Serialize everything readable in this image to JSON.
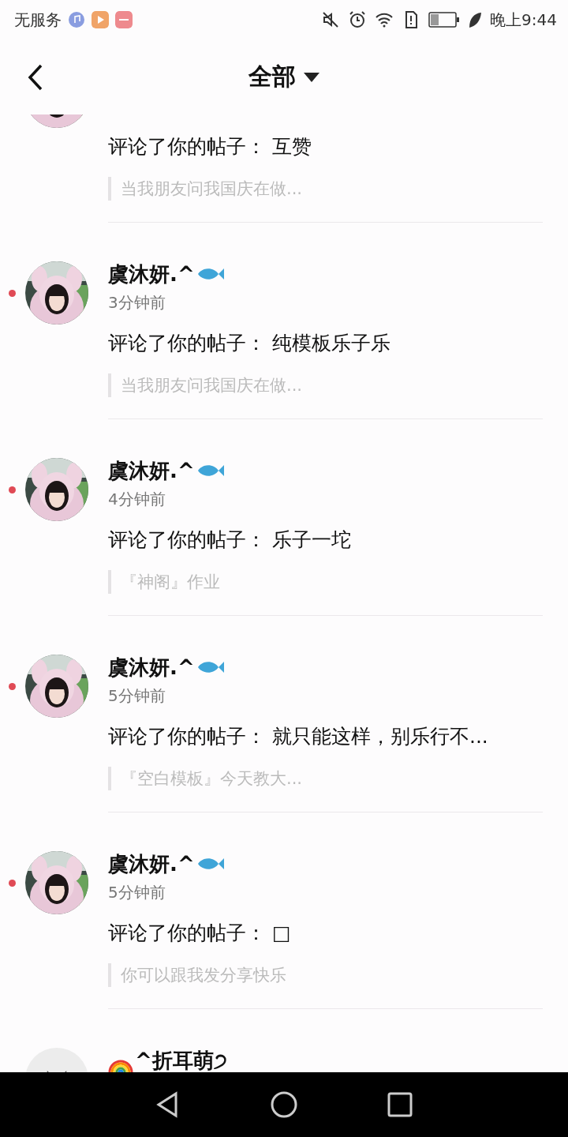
{
  "status_bar": {
    "carrier": "无服务",
    "time": "晚上9:44"
  },
  "header": {
    "title": "全部"
  },
  "notifications": [
    {
      "kind": "partial",
      "comment": "评论了你的帖子： 互赞",
      "quote": "当我朋友问我国庆在做..."
    },
    {
      "kind": "full",
      "unread": true,
      "name": "虞沐妍.^",
      "time": "3分钟前",
      "comment": "评论了你的帖子： 纯模板乐子乐",
      "quote": "当我朋友问我国庆在做..."
    },
    {
      "kind": "full",
      "unread": true,
      "name": "虞沐妍.^",
      "time": "4分钟前",
      "comment": "评论了你的帖子： 乐子一坨",
      "quote": "『神阁』作业"
    },
    {
      "kind": "full",
      "unread": true,
      "name": "虞沐妍.^",
      "time": "5分钟前",
      "comment": "评论了你的帖子： 就只能这样，别乐行不...",
      "quote": "『空白模板』今天教大..."
    },
    {
      "kind": "full",
      "unread": true,
      "name": "虞沐妍.^",
      "time": "5分钟前",
      "comment": "评论了你的帖子： □",
      "quote": "你可以跟我发分享快乐"
    },
    {
      "kind": "cut",
      "avatar": {
        "kind": "default"
      },
      "name": "^折耳萌੭"
    }
  ]
}
